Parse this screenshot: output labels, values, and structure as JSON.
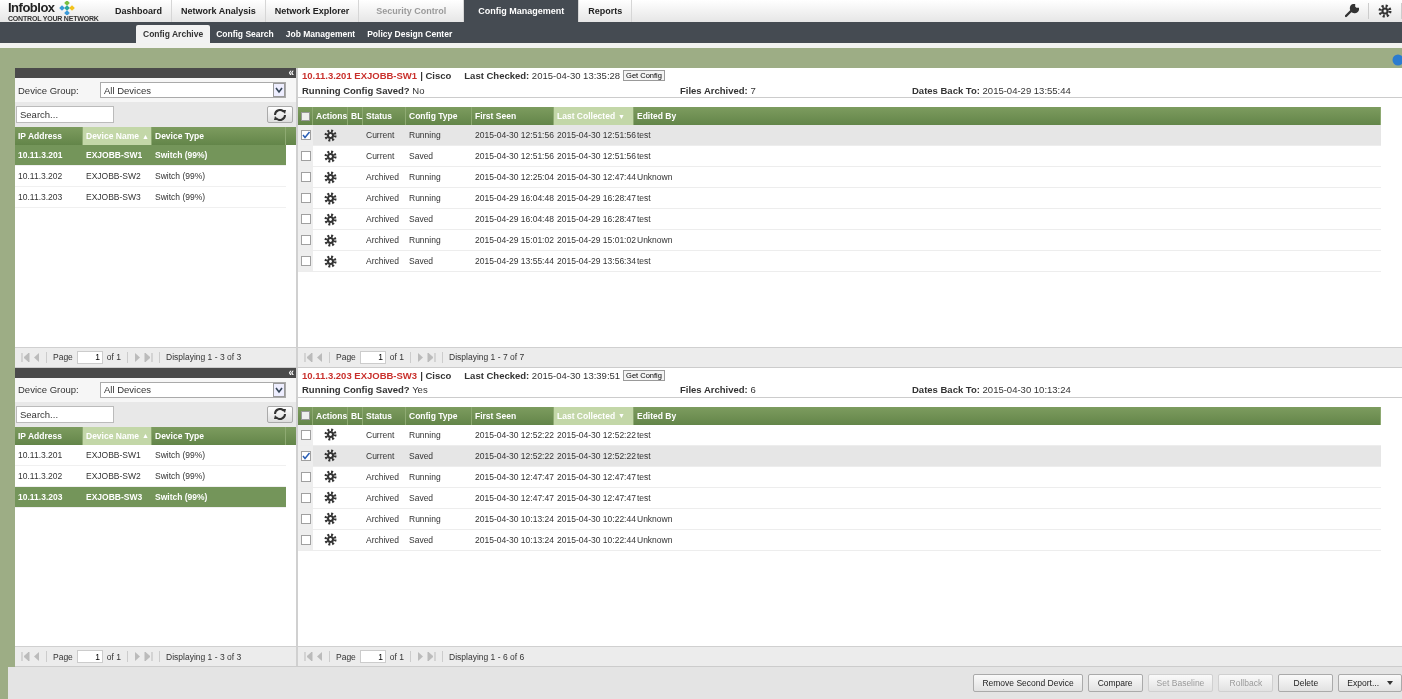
{
  "nav": {
    "logo": "Infoblox",
    "tagline": "CONTROL YOUR NETWORK",
    "tabs": [
      {
        "label": "Dashboard",
        "selected": false,
        "disabled": false
      },
      {
        "label": "Network Analysis",
        "selected": false,
        "disabled": false
      },
      {
        "label": "Network Explorer",
        "selected": false,
        "disabled": false
      },
      {
        "label": "Security Control",
        "selected": false,
        "disabled": true
      },
      {
        "label": "Config Management",
        "selected": true,
        "disabled": false
      },
      {
        "label": "Reports",
        "selected": false,
        "disabled": false
      }
    ]
  },
  "subtabs": [
    {
      "label": "Config Archive",
      "selected": true
    },
    {
      "label": "Config Search",
      "selected": false
    },
    {
      "label": "Job Management",
      "selected": false
    },
    {
      "label": "Policy Design Center",
      "selected": false
    }
  ],
  "panes": [
    {
      "device_list": {
        "collapse": "«",
        "group_label": "Device Group:",
        "group_value": "All Devices",
        "search_placeholder": "Search...",
        "columns": [
          {
            "label": "IP Address"
          },
          {
            "label": "Device Name",
            "sort_arrow": "▲"
          },
          {
            "label": "Device Type"
          }
        ],
        "rows": [
          {
            "ip": "10.11.3.201",
            "name": "EXJOBB-SW1",
            "type": "Switch (99%)",
            "selected": true
          },
          {
            "ip": "10.11.3.202",
            "name": "EXJOBB-SW2",
            "type": "Switch (99%)",
            "selected": false
          },
          {
            "ip": "10.11.3.203",
            "name": "EXJOBB-SW3",
            "type": "Switch (99%)",
            "selected": false
          }
        ],
        "pager": {
          "page_label": "Page",
          "page": "1",
          "of": "of 1",
          "display": "Displaying 1 - 3 of 3"
        }
      },
      "config": {
        "device": "10.11.3.201 EXJOBB-SW1",
        "vendor": "| Cisco",
        "last_checked": "**Last Checked:** 2015-04-30 13:35:28",
        "get_config": "Get Config",
        "saved": "**Running Config Saved?** No",
        "files": "**Files Archived:** 7",
        "dates": "**Dates Back To:** 2015-04-29 13:55:44",
        "all_checked": false,
        "columns": [
          {
            "label": "Actions"
          },
          {
            "label": "BL"
          },
          {
            "label": "Status"
          },
          {
            "label": "Config Type"
          },
          {
            "label": "First Seen"
          },
          {
            "label": "Last Collected",
            "sort_arrow": "▼"
          },
          {
            "label": "Edited By"
          }
        ],
        "rows": [
          {
            "checked": true,
            "status": "Current",
            "config_type": "Running",
            "first_seen": "2015-04-30 12:51:56",
            "last_collected": "2015-04-30 12:51:56",
            "edited_by": "test"
          },
          {
            "checked": false,
            "status": "Current",
            "config_type": "Saved",
            "first_seen": "2015-04-30 12:51:56",
            "last_collected": "2015-04-30 12:51:56",
            "edited_by": "test"
          },
          {
            "checked": false,
            "status": "Archived",
            "config_type": "Running",
            "first_seen": "2015-04-30 12:25:04",
            "last_collected": "2015-04-30 12:47:44",
            "edited_by": "Unknown"
          },
          {
            "checked": false,
            "status": "Archived",
            "config_type": "Running",
            "first_seen": "2015-04-29 16:04:48",
            "last_collected": "2015-04-29 16:28:47",
            "edited_by": "test"
          },
          {
            "checked": false,
            "status": "Archived",
            "config_type": "Saved",
            "first_seen": "2015-04-29 16:04:48",
            "last_collected": "2015-04-29 16:28:47",
            "edited_by": "test"
          },
          {
            "checked": false,
            "status": "Archived",
            "config_type": "Running",
            "first_seen": "2015-04-29 15:01:02",
            "last_collected": "2015-04-29 15:01:02",
            "edited_by": "Unknown"
          },
          {
            "checked": false,
            "status": "Archived",
            "config_type": "Saved",
            "first_seen": "2015-04-29 13:55:44",
            "last_collected": "2015-04-29 13:56:34",
            "edited_by": "test"
          }
        ],
        "pager": {
          "page_label": "Page",
          "page": "1",
          "of": "of 1",
          "display": "Displaying 1 - 7 of 7"
        }
      }
    },
    {
      "device_list": {
        "collapse": "«",
        "group_label": "Device Group:",
        "group_value": "All Devices",
        "search_placeholder": "Search...",
        "columns": [
          {
            "label": "IP Address"
          },
          {
            "label": "Device Name",
            "sort_arrow": "▲"
          },
          {
            "label": "Device Type"
          }
        ],
        "rows": [
          {
            "ip": "10.11.3.201",
            "name": "EXJOBB-SW1",
            "type": "Switch (99%)",
            "selected": false
          },
          {
            "ip": "10.11.3.202",
            "name": "EXJOBB-SW2",
            "type": "Switch (99%)",
            "selected": false
          },
          {
            "ip": "10.11.3.203",
            "name": "EXJOBB-SW3",
            "type": "Switch (99%)",
            "selected": true
          }
        ],
        "pager": {
          "page_label": "Page",
          "page": "1",
          "of": "of 1",
          "display": "Displaying 1 - 3 of 3"
        }
      },
      "config": {
        "device": "10.11.3.203 EXJOBB-SW3",
        "vendor": "| Cisco",
        "last_checked": "**Last Checked:** 2015-04-30 13:39:51",
        "get_config": "Get Config",
        "saved": "**Running Config Saved?** Yes",
        "files": "**Files Archived:** 6",
        "dates": "**Dates Back To:** 2015-04-30 10:13:24",
        "all_checked": false,
        "columns": [
          {
            "label": "Actions"
          },
          {
            "label": "BL"
          },
          {
            "label": "Status"
          },
          {
            "label": "Config Type"
          },
          {
            "label": "First Seen"
          },
          {
            "label": "Last Collected",
            "sort_arrow": "▼"
          },
          {
            "label": "Edited By"
          }
        ],
        "rows": [
          {
            "checked": false,
            "status": "Current",
            "config_type": "Running",
            "first_seen": "2015-04-30 12:52:22",
            "last_collected": "2015-04-30 12:52:22",
            "edited_by": "test"
          },
          {
            "checked": true,
            "status": "Current",
            "config_type": "Saved",
            "first_seen": "2015-04-30 12:52:22",
            "last_collected": "2015-04-30 12:52:22",
            "edited_by": "test"
          },
          {
            "checked": false,
            "status": "Archived",
            "config_type": "Running",
            "first_seen": "2015-04-30 12:47:47",
            "last_collected": "2015-04-30 12:47:47",
            "edited_by": "test"
          },
          {
            "checked": false,
            "status": "Archived",
            "config_type": "Saved",
            "first_seen": "2015-04-30 12:47:47",
            "last_collected": "2015-04-30 12:47:47",
            "edited_by": "test"
          },
          {
            "checked": false,
            "status": "Archived",
            "config_type": "Running",
            "first_seen": "2015-04-30 10:13:24",
            "last_collected": "2015-04-30 10:22:44",
            "edited_by": "Unknown"
          },
          {
            "checked": false,
            "status": "Archived",
            "config_type": "Saved",
            "first_seen": "2015-04-30 10:13:24",
            "last_collected": "2015-04-30 10:22:44",
            "edited_by": "Unknown"
          }
        ],
        "pager": {
          "page_label": "Page",
          "page": "1",
          "of": "of 1",
          "display": "Displaying 1 - 6 of 6"
        }
      }
    }
  ],
  "buttons": [
    {
      "label": "Remove Second Device",
      "disabled": false,
      "kind": "plain"
    },
    {
      "label": "Compare",
      "disabled": false,
      "kind": "plain"
    },
    {
      "label": "Set Baseline",
      "disabled": true,
      "kind": "plain"
    },
    {
      "label": "Rollback",
      "disabled": true,
      "kind": "plain"
    },
    {
      "label": "Delete",
      "disabled": false,
      "kind": "plain"
    },
    {
      "label": "Export...",
      "disabled": false,
      "kind": "menu"
    }
  ]
}
